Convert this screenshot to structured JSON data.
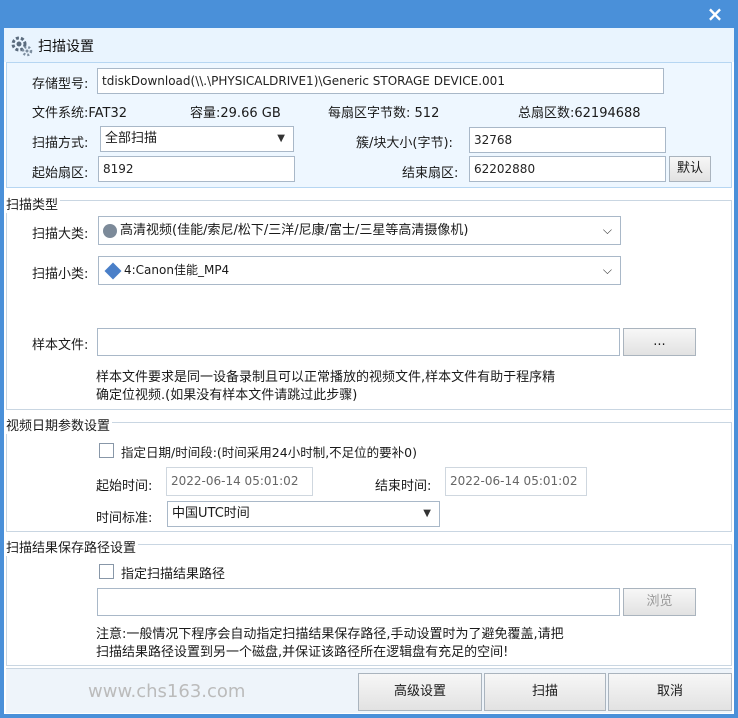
{
  "window": {
    "title": "扫描设置",
    "close": "×"
  },
  "storage": {
    "model_label": "存储型号:",
    "model_value": "tdiskDownload(\\\\.\\PHYSICALDRIVE1)\\Generic STORAGE DEVICE.001",
    "fs_label": "文件系统:",
    "fs_value": "FAT32",
    "capacity_label": "容量:",
    "capacity_value": "29.66 GB",
    "bytes_label": "每扇区字节数:",
    "bytes_value": "512",
    "sectors_label": "总扇区数:",
    "sectors_value": "62194688",
    "scan_mode_label": "扫描方式:",
    "scan_mode_value": "全部扫描",
    "cluster_label": "簇/块大小(字节):",
    "cluster_value": "32768",
    "start_sector_label": "起始扇区:",
    "start_sector_value": "8192",
    "end_sector_label": "结束扇区:",
    "end_sector_value": "62202880",
    "default_button": "默认"
  },
  "scan_type": {
    "section_title": "扫描类型",
    "major_label": "扫描大类:",
    "major_value": "高清视频(佳能/索尼/松下/三洋/尼康/富士/三星等高清摄像机)",
    "minor_label": "扫描小类:",
    "minor_value": "4:Canon佳能_MP4",
    "sample_label": "样本文件:",
    "sample_value": "",
    "browse_dots": "...",
    "note_line1": "样本文件要求是同一设备录制且可以正常播放的视频文件,样本文件有助于程序精",
    "note_line2": "确定位视频.(如果没有样本文件请跳过此步骤)"
  },
  "date_params": {
    "section_title": "视频日期参数设置",
    "checkbox_label": "指定日期/时间段:(时间采用24小时制,不足位的要补0)",
    "start_label": "起始时间:",
    "start_value": "2022-06-14 05:01:02",
    "end_label": "结束时间:",
    "end_value": "2022-06-14 05:01:02",
    "tz_label": "时间标准:",
    "tz_value": "中国UTC时间"
  },
  "save_path": {
    "section_title": "扫描结果保存路径设置",
    "checkbox_label": "指定扫描结果路径",
    "path_value": "",
    "browse_button": "浏览",
    "note_line1": "注意:一般情况下程序会自动指定扫描结果保存路径,手动设置时为了避免覆盖,请把",
    "note_line2": "扫描结果路径设置到另一个磁盘,并保证该路径所在逻辑盘有充足的空间!"
  },
  "footer": {
    "watermark": "www.chs163.com",
    "advanced_button": "高级设置",
    "scan_button": "扫描",
    "cancel_button": "取消"
  },
  "colors": {
    "frame": "#4a90d9",
    "panel": "#eef7ff"
  }
}
